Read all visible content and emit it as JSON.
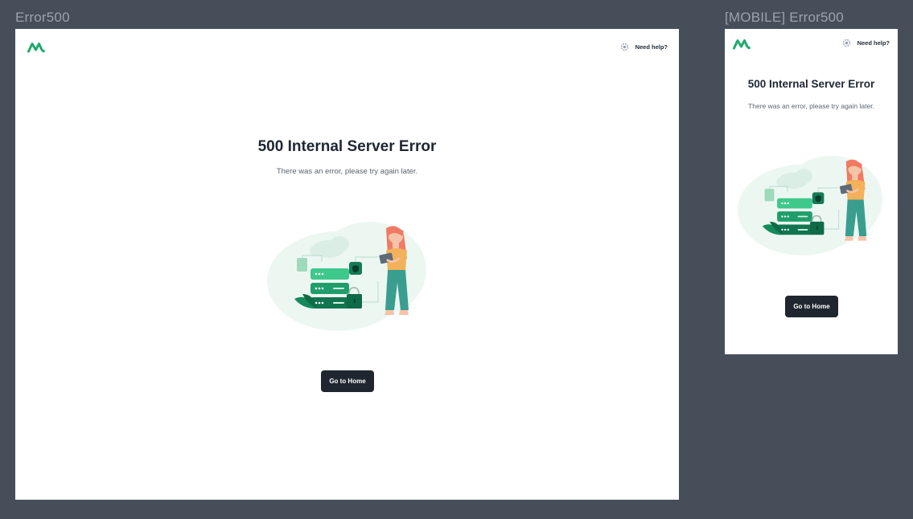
{
  "frames": {
    "desktop_label": "Error500",
    "mobile_label": "[MOBILE] Error500"
  },
  "header": {
    "logo_icon": "brand-logo-icon",
    "help_icon": "gear-icon",
    "help_label": "Need help?"
  },
  "error": {
    "title": "500 Internal Server Error",
    "message": "There was an error, please try again later.",
    "illustration": "server-error-illustration",
    "button_label": "Go to Home"
  },
  "colors": {
    "background": "#454e59",
    "frame": "#ffffff",
    "accent": "#1faa6e",
    "button": "#1f262f",
    "title": "#1e2632",
    "subtitle": "#5b6470"
  }
}
